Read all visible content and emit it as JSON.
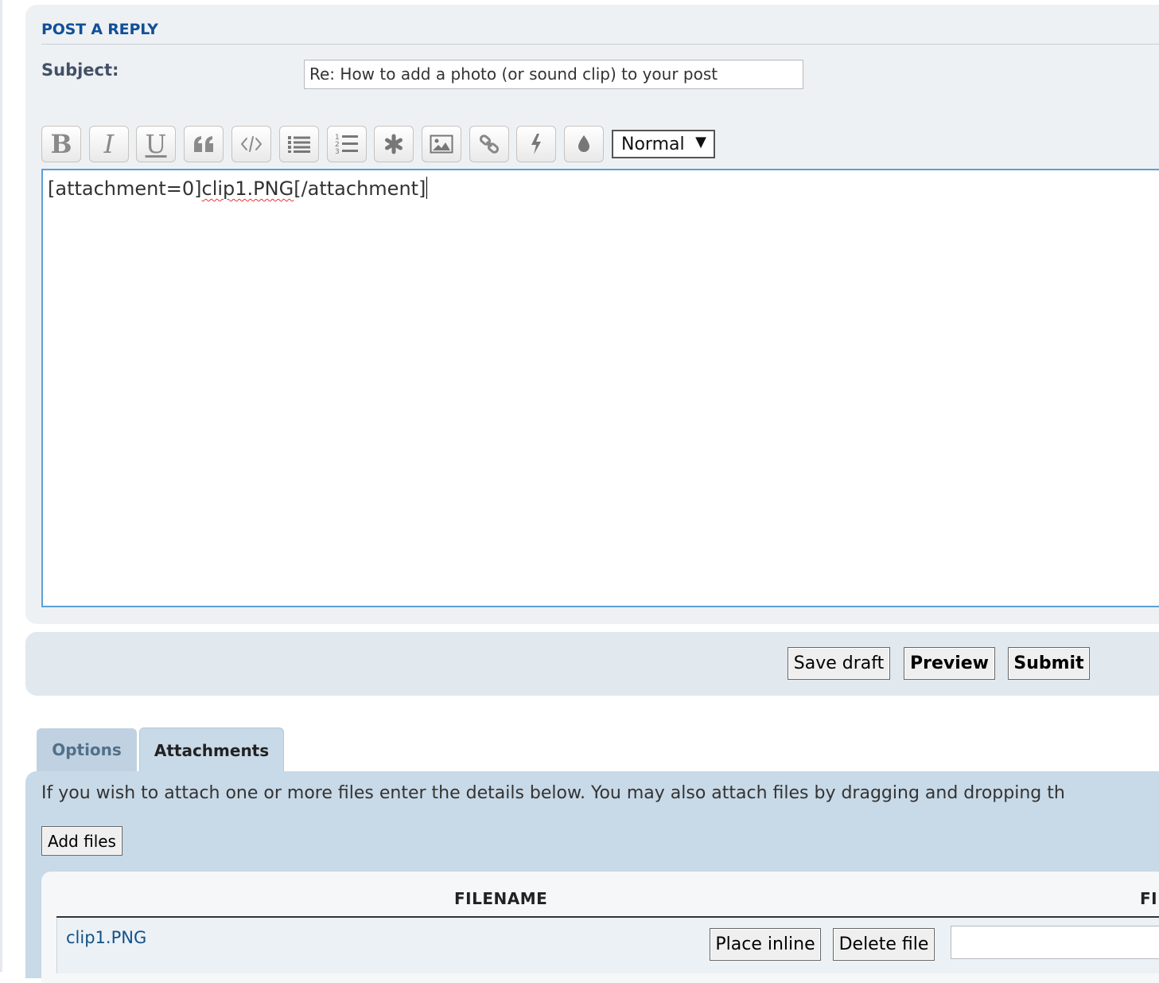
{
  "form": {
    "heading": "POST A REPLY",
    "subject_label": "Subject:",
    "subject_value": "Re: How to add a photo (or sound clip) to your post"
  },
  "toolbar": {
    "buttons": [
      {
        "name": "bold",
        "label": "B",
        "icon": "bold-icon"
      },
      {
        "name": "italic",
        "label": "I",
        "icon": "italic-icon"
      },
      {
        "name": "underline",
        "label": "U",
        "icon": "underline-icon"
      },
      {
        "name": "quote",
        "icon": "quote-icon"
      },
      {
        "name": "code",
        "icon": "code-icon"
      },
      {
        "name": "list",
        "icon": "bullet-list-icon"
      },
      {
        "name": "ordered-list",
        "icon": "numbered-list-icon"
      },
      {
        "name": "list-item",
        "icon": "asterisk-icon"
      },
      {
        "name": "image",
        "icon": "image-icon"
      },
      {
        "name": "url",
        "icon": "link-icon"
      },
      {
        "name": "flash",
        "icon": "lightning-icon"
      },
      {
        "name": "color",
        "icon": "droplet-icon"
      }
    ],
    "font_size": {
      "selected": "Normal",
      "arrow": "▼"
    }
  },
  "editor": {
    "text_before": "[attachment=0]",
    "text_misspelled": "clip1.PNG",
    "text_after": "[/attachment]"
  },
  "actions": {
    "save_draft": "Save draft",
    "preview": "Preview",
    "submit": "Submit"
  },
  "tabs": [
    {
      "label": "Options",
      "active": false
    },
    {
      "label": "Attachments",
      "active": true
    }
  ],
  "attachments": {
    "instructions": "If you wish to attach one or more files enter the details below. You may also attach files by dragging and dropping th",
    "add_files": "Add files",
    "columns": {
      "filename": "FILENAME",
      "comment": "FI"
    },
    "rows": [
      {
        "filename": "clip1.PNG",
        "place_inline": "Place inline",
        "delete_file": "Delete file"
      }
    ]
  },
  "colors": {
    "heading": "#115098",
    "link": "#105289",
    "editor_border": "#5aa1d9",
    "panel": "#eef1f4",
    "attach_panel": "#c8d9e7"
  }
}
